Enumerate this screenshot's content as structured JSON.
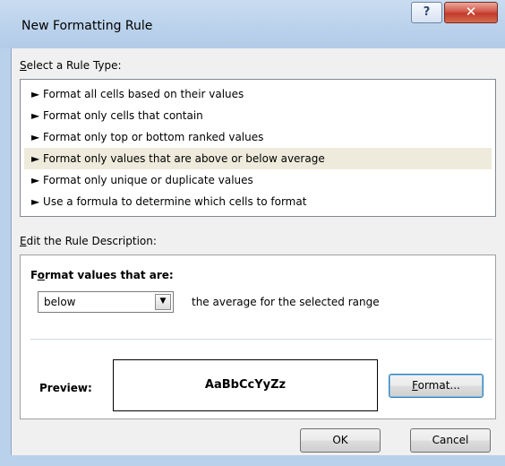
{
  "window": {
    "title": "New Formatting Rule",
    "help_glyph": "?",
    "close_glyph": "✕"
  },
  "rule_type": {
    "label_u": "S",
    "label_rest": "elect a Rule Type:",
    "items": [
      {
        "label": "► Format all cells based on their values"
      },
      {
        "label": "► Format only cells that contain"
      },
      {
        "label": "► Format only top or bottom ranked values"
      },
      {
        "label": "► Format only values that are above or below average"
      },
      {
        "label": "► Format only unique or duplicate values"
      },
      {
        "label": "► Use a formula to determine which cells to format"
      }
    ],
    "selected_index": 3
  },
  "description": {
    "label_u": "E",
    "label_rest": "dit the Rule Description:",
    "heading_pre": "F",
    "heading_u": "o",
    "heading_rest": "rmat values that are:",
    "combo_value": "below",
    "combo_arrow": "▼",
    "average_text": "the average for the selected range",
    "preview_label": "Preview:",
    "preview_sample": "AaBbCcYyZz",
    "format_button_u": "F",
    "format_button_rest": "ormat..."
  },
  "buttons": {
    "ok": "OK",
    "cancel": "Cancel"
  },
  "colors": {
    "selected_row": "#eeebdc",
    "titlebar": "#bcd3ec",
    "close": "#c9493a"
  }
}
